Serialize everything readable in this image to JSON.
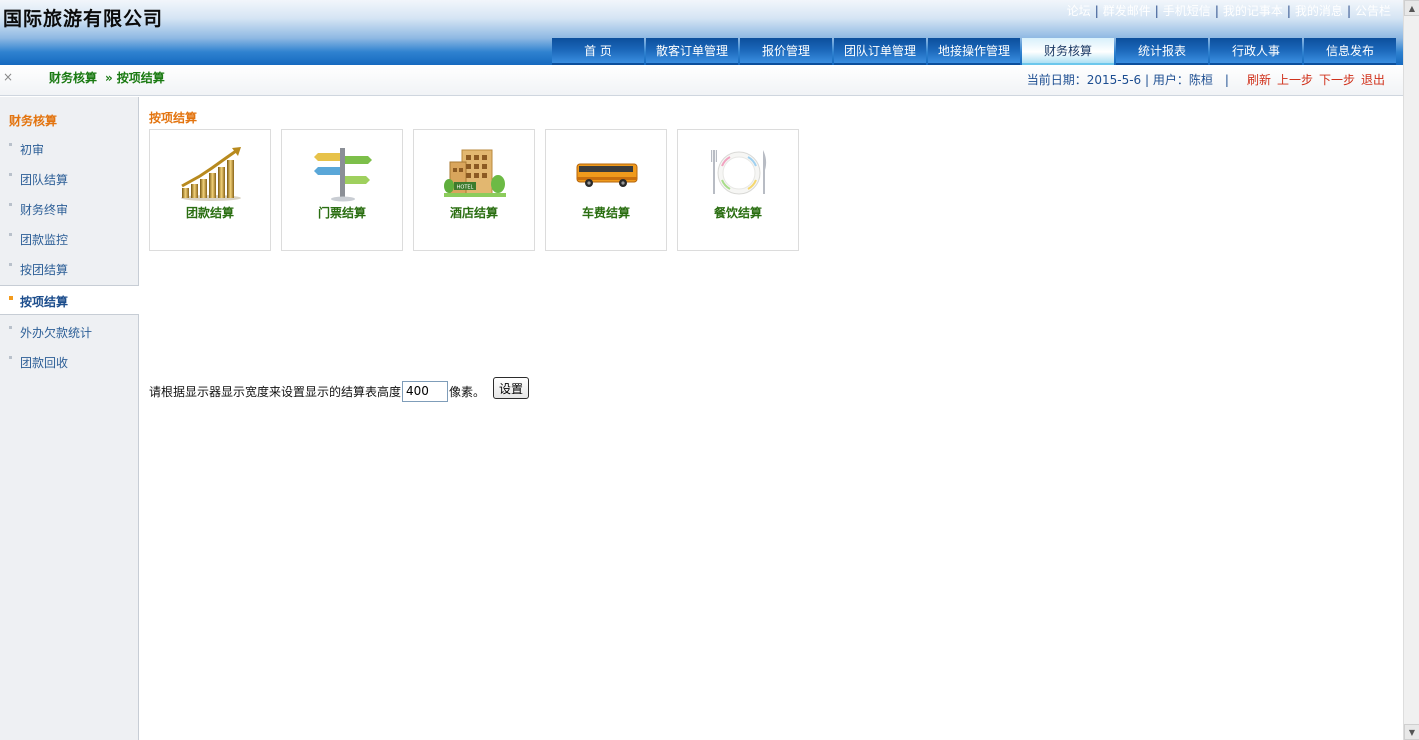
{
  "header": {
    "app_title": "国际旅游有限公司",
    "top_links": [
      "论坛",
      "群发邮件",
      "手机短信",
      "我的记事本",
      "我的消息",
      "公告栏"
    ],
    "nav_tabs": [
      {
        "label": "首 页",
        "active": false
      },
      {
        "label": "散客订单管理",
        "active": false
      },
      {
        "label": "报价管理",
        "active": false
      },
      {
        "label": "团队订单管理",
        "active": false
      },
      {
        "label": "地接操作管理",
        "active": false
      },
      {
        "label": "财务核算",
        "active": true
      },
      {
        "label": "统计报表",
        "active": false
      },
      {
        "label": "行政人事",
        "active": false
      },
      {
        "label": "信息发布",
        "active": false
      }
    ]
  },
  "breadcrumb": {
    "close_icon": "×",
    "root": "财务核算",
    "arrow": "»",
    "current": "按项结算"
  },
  "status": {
    "date_text": "当前日期：2015-5-6",
    "user_text": "用户：陈桓",
    "pipe": "|",
    "actions": [
      "刷新",
      "上一步",
      "下一步",
      "退出"
    ]
  },
  "sidebar": {
    "title": "财务核算",
    "items": [
      {
        "label": "初审",
        "active": false
      },
      {
        "label": "团队结算",
        "active": false
      },
      {
        "label": "财务终审",
        "active": false
      },
      {
        "label": "团款监控",
        "active": false
      },
      {
        "label": "按团结算",
        "active": false
      },
      {
        "label": "按项结算",
        "active": true
      },
      {
        "label": "外办欠款统计",
        "active": false
      },
      {
        "label": "团款回收",
        "active": false
      }
    ]
  },
  "content": {
    "section_title": "按项结算",
    "tiles": [
      {
        "label": "团款结算",
        "icon": "rising-bar-chart-icon"
      },
      {
        "label": "门票结算",
        "icon": "signpost-icon"
      },
      {
        "label": "酒店结算",
        "icon": "hotel-building-icon"
      },
      {
        "label": "车费结算",
        "icon": "bus-icon"
      },
      {
        "label": "餐饮结算",
        "icon": "plate-cutlery-icon"
      }
    ],
    "setting": {
      "prefix": "请根据显示器显示宽度来设置显示的结算表高度",
      "value": "400",
      "suffix": "像素。",
      "button_label": "设置"
    }
  },
  "scrollbar": {
    "up_arrow": "▲",
    "down_arrow": "▼"
  },
  "colors": {
    "header_blue": "#1669bf",
    "tab_active": "#e0f4fb",
    "breadcrumb_green": "#1a7a12",
    "title_orange": "#e3740f",
    "action_red": "#d0301a",
    "tile_label_green": "#2a6e11"
  }
}
